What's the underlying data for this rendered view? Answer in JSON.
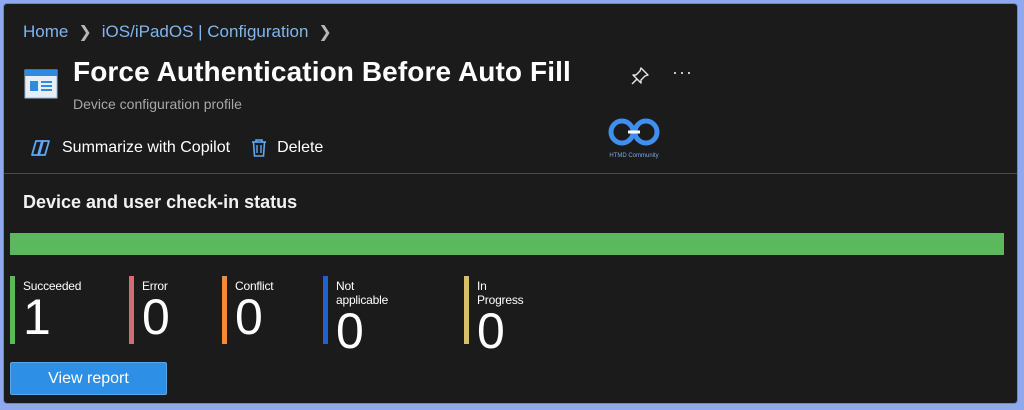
{
  "breadcrumb": {
    "items": [
      "Home",
      "iOS/iPadOS | Configuration"
    ]
  },
  "header": {
    "title": "Force Authentication Before Auto Fill",
    "subtitle": "Device configuration profile",
    "icons": [
      "profile-icon",
      "pin-icon",
      "more-icon"
    ],
    "more_glyph": "···"
  },
  "watermark": {
    "text": "HTMD Community"
  },
  "toolbar": {
    "summarize_label": "Summarize with Copilot",
    "delete_label": "Delete"
  },
  "status": {
    "title": "Device and user check-in status",
    "success_fraction": 1.0,
    "bar_color": "#5cb85c",
    "items": [
      {
        "label": "Succeeded",
        "value": "1",
        "color": "#5cb85c"
      },
      {
        "label": "Error",
        "value": "0",
        "color": "#d36b78"
      },
      {
        "label": "Conflict",
        "value": "0",
        "color": "#f08a3c"
      },
      {
        "label": "Not applicable",
        "value": "0",
        "color": "#1f63d3"
      },
      {
        "label": "In Progress",
        "value": "0",
        "color": "#d8c06a"
      }
    ]
  },
  "actions": {
    "view_report_label": "View report"
  }
}
